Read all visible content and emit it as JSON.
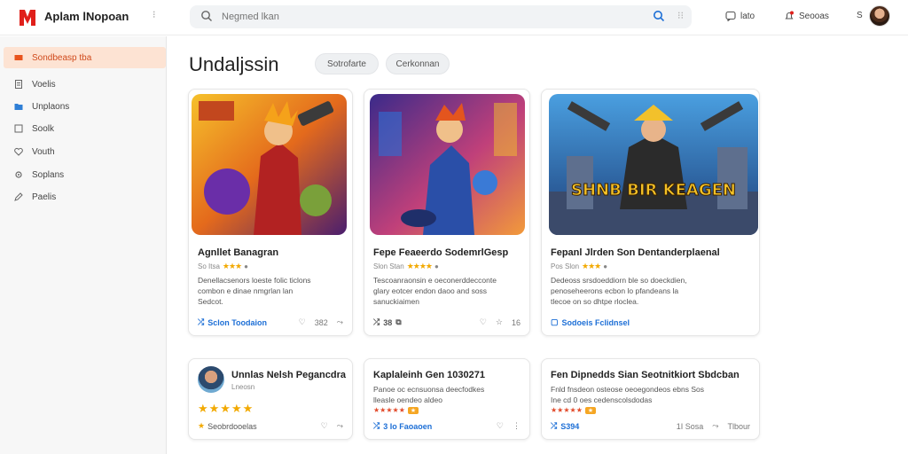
{
  "app": {
    "title": "Aplam lNopoan",
    "menu_dots": "⁝"
  },
  "search": {
    "placeholder": "Negmed lkan",
    "clear": "⁝⁝"
  },
  "top_actions": [
    {
      "label": "lato",
      "icon": "chat-icon"
    },
    {
      "label": "Seooas",
      "icon": "notification-icon"
    },
    {
      "label": "S",
      "icon": ""
    }
  ],
  "sidebar": {
    "items": [
      {
        "label": "Sondbeasp tba",
        "icon": "home-icon",
        "active": true
      },
      {
        "label": "Voelis",
        "icon": "document-icon"
      },
      {
        "label": "Unplaons",
        "icon": "folder-icon"
      },
      {
        "label": "Soolk",
        "icon": "square-icon"
      },
      {
        "label": "Vouth",
        "icon": "heart-icon"
      },
      {
        "label": "Soplans",
        "icon": "gear-icon"
      },
      {
        "label": "Paelis",
        "icon": "pen-icon"
      }
    ]
  },
  "main": {
    "heading": "Undaljssin",
    "filters": [
      "Sotrofarte",
      "Cerkonnan"
    ]
  },
  "cards": [
    {
      "title": "Agnllet Banagran",
      "meta": "So Itsa",
      "desc": [
        "Denellacsenors loeste folic ticlons",
        "combon e dinae nmgrlan lan",
        "Sedcot."
      ],
      "link": "Sclon Toodaion",
      "likes": "382",
      "share": "⤳"
    },
    {
      "title": "Fepe Feaeerdo SodemrlGesp",
      "meta": "Slon Stan",
      "desc": [
        "Tescoanraonsin e oeconerddecconte",
        "glary eotcer endon daoo and soss",
        "sanuckiaimen"
      ],
      "link": "38",
      "likes": "",
      "share": "16"
    },
    {
      "title": "Fepanl Jlrden Son Dentanderplaenal",
      "meta": "Pos Slon",
      "desc": [
        "Dedeoss srsdoeddiorn ble so doeckdien,",
        "penoseheerons ecbon lo pfandeans la",
        "tlecoe on so dhtpe rloclea."
      ],
      "link": "Sodoeis Fclidnsel",
      "likes": "",
      "share": ""
    },
    {
      "title": "Unnlas Nelsh Pegancdra",
      "meta": "Lneosn",
      "desc": [],
      "link": "Seobrdooelas",
      "likes": "",
      "share": "⤳"
    },
    {
      "title": "Kaplaleinh Gen 1030271",
      "meta": "",
      "desc": [
        "Panoe oc ecnsuonsa deecfodkes",
        "lleasle oendeo aldeo"
      ],
      "link": "3 Io Faoaoen",
      "likes": "",
      "share": ""
    },
    {
      "title": "Fen Dipnedds Sian Seotnitkiort Sbdcban",
      "meta": "",
      "desc": [
        "Fnld fnsdeon osteose oeoegondeos ebns Sos",
        "Ine cd 0 oes cedenscolsdodas"
      ],
      "link": "S394",
      "likes": "1I Sosa",
      "share": "Tlbour"
    }
  ],
  "thumbs": [
    {
      "caption": ""
    },
    {
      "caption": ""
    },
    {
      "caption": "SHNB BIR KEAGEN"
    }
  ],
  "colors": {
    "accent": "#d04a1c",
    "link": "#1d6fd6",
    "star": "#f2a900"
  }
}
